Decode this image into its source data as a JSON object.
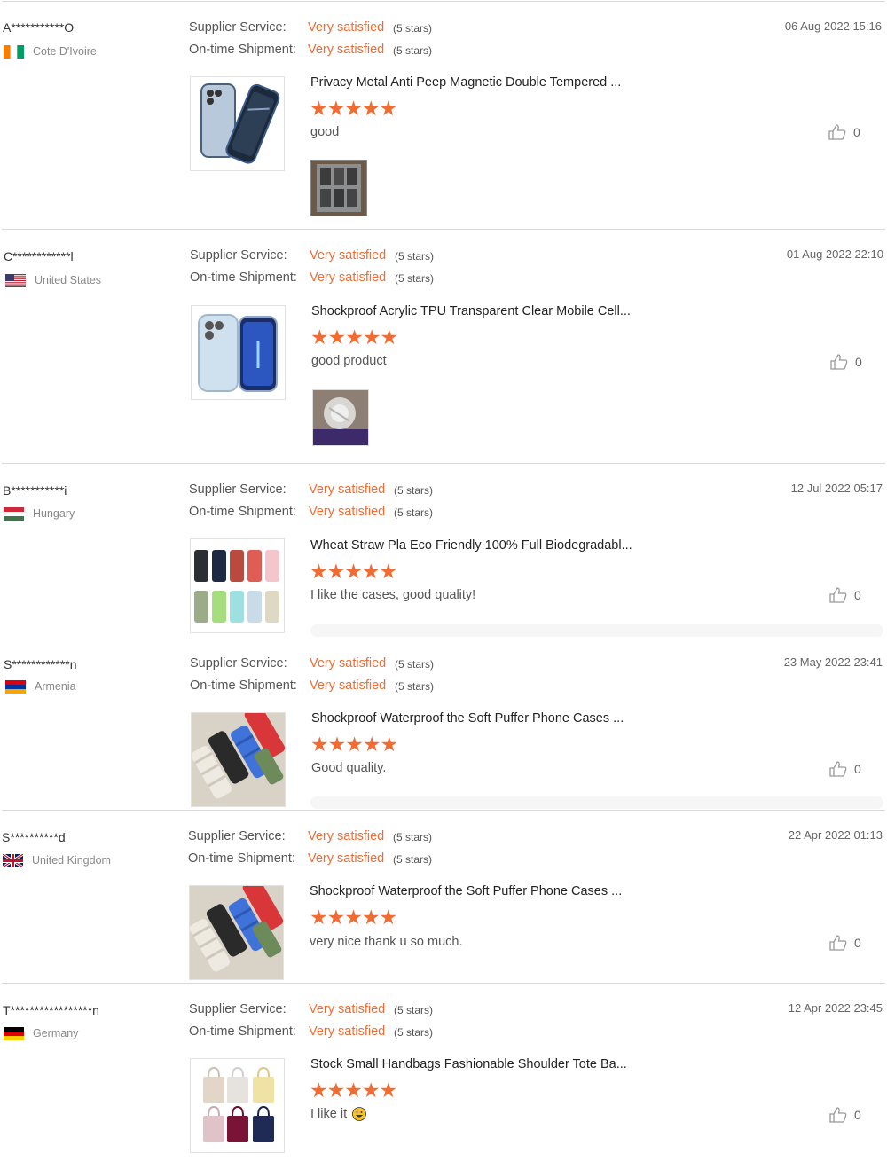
{
  "labels": {
    "supplier_service": "Supplier Service:",
    "ontime_shipment": "On-time Shipment:"
  },
  "colors": {
    "accent": "#f06c33",
    "separator": "#d9d9d9",
    "muted": "#888888"
  },
  "reviews": [
    {
      "name": "A***********O",
      "country": "Cote D'Ivoire",
      "flag": "flag-cote-divoire-icon",
      "supplier_rating": "Very satisfied",
      "supplier_stars": "(5 stars)",
      "shipment_rating": "Very satisfied",
      "shipment_stars": "(5 stars)",
      "date": "06 Aug 2022 15:16",
      "product": "Privacy Metal Anti Peep Magnetic Double Tempered ...",
      "rating": 5,
      "stars_text": "★★★★★",
      "comment": "good",
      "likes": "0",
      "has_photo": true
    },
    {
      "name": "C************l",
      "country": "United States",
      "flag": "flag-united-states-icon",
      "supplier_rating": "Very satisfied",
      "supplier_stars": "(5 stars)",
      "shipment_rating": "Very satisfied",
      "shipment_stars": "(5 stars)",
      "date": "01 Aug 2022 22:10",
      "product": "Shockproof Acrylic TPU Transparent Clear Mobile Cell...",
      "rating": 5,
      "stars_text": "★★★★★",
      "comment": "good product",
      "likes": "0",
      "has_photo": true
    },
    {
      "name": "B***********i",
      "country": "Hungary",
      "flag": "flag-hungary-icon",
      "supplier_rating": "Very satisfied",
      "supplier_stars": "(5 stars)",
      "shipment_rating": "Very satisfied",
      "shipment_stars": "(5 stars)",
      "date": "12 Jul 2022 05:17",
      "product": "Wheat Straw Pla Eco Friendly 100% Full Biodegradabl...",
      "rating": 5,
      "stars_text": "★★★★★",
      "comment": "I like the cases, good quality!",
      "likes": "0",
      "has_photo": false
    },
    {
      "name": "S************n",
      "country": "Armenia",
      "flag": "flag-armenia-icon",
      "supplier_rating": "Very satisfied",
      "supplier_stars": "(5 stars)",
      "shipment_rating": "Very satisfied",
      "shipment_stars": "(5 stars)",
      "date": "23 May 2022 23:41",
      "product": "Shockproof Waterproof the Soft Puffer Phone Cases ...",
      "rating": 5,
      "stars_text": "★★★★★",
      "comment": "Good quality.",
      "likes": "0",
      "has_photo": false
    },
    {
      "name": "S**********d",
      "country": "United Kingdom",
      "flag": "flag-united-kingdom-icon",
      "supplier_rating": "Very satisfied",
      "supplier_stars": "(5 stars)",
      "shipment_rating": "Very satisfied",
      "shipment_stars": "(5 stars)",
      "date": "22 Apr 2022 01:13",
      "product": "Shockproof Waterproof the Soft Puffer Phone Cases ...",
      "rating": 5,
      "stars_text": "★★★★★",
      "comment": "very nice thank u so much.",
      "likes": "0",
      "has_photo": false
    },
    {
      "name": "T*****************n",
      "country": "Germany",
      "flag": "flag-germany-icon",
      "supplier_rating": "Very satisfied",
      "supplier_stars": "(5 stars)",
      "shipment_rating": "Very satisfied",
      "shipment_stars": "(5 stars)",
      "date": "12 Apr 2022 23:45",
      "product": "Stock Small Handbags Fashionable Shoulder Tote Ba...",
      "rating": 5,
      "stars_text": "★★★★★",
      "comment": "I like it",
      "comment_emoji": "grinning-face-icon",
      "likes": "0",
      "has_photo": false
    }
  ]
}
